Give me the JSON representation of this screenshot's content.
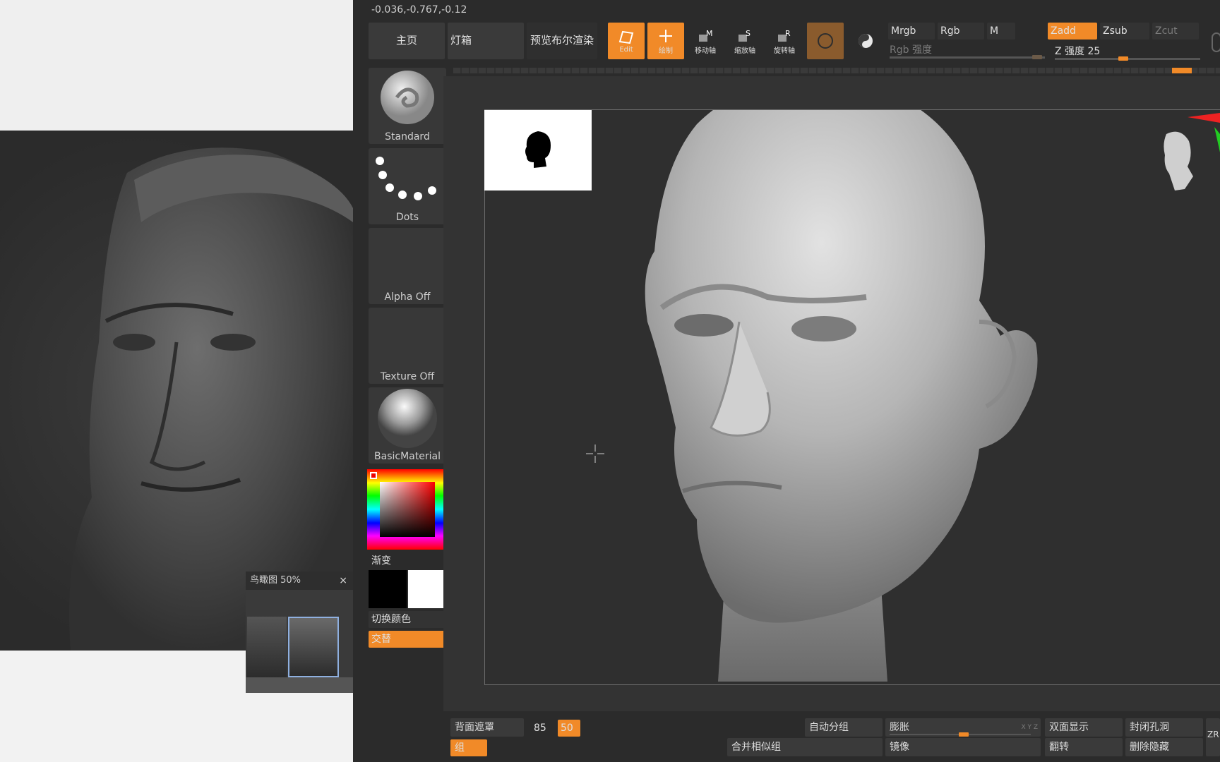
{
  "coords": "-0.036,-0.767,-0.12",
  "tabs": {
    "home": "主页",
    "lightbox": "灯箱",
    "preview_render": "预览布尔渲染"
  },
  "tools": {
    "edit": "Edit",
    "draw": "绘制",
    "move": "移动轴",
    "scale": "缩放轴",
    "rotate": "旋转轴",
    "move_badge": "M",
    "scale_badge": "S",
    "rotate_badge": "R"
  },
  "color_modes": {
    "mrgb": "Mrgb",
    "rgb": "Rgb",
    "m": "M",
    "rgb_intensity": "Rgb 强度"
  },
  "z_modes": {
    "zadd": "Zadd",
    "zsub": "Zsub",
    "zcut": "Zcut",
    "z_intensity_label": "Z 强度",
    "z_intensity_value": "25"
  },
  "palette": {
    "brush": "Standard",
    "stroke": "Dots",
    "alpha": "Alpha Off",
    "texture": "Texture Off",
    "material": "BasicMaterial",
    "gradient": "渐变",
    "switch_color": "切换颜色",
    "alternate": "交替"
  },
  "navigator": {
    "title": "鸟瞰图 50%",
    "close": "×"
  },
  "bottom": {
    "backface_mask": "背面遮罩",
    "backface_value1": "85",
    "backface_value2": "50",
    "group": "组",
    "auto_group": "自动分组",
    "merge_similar": "合并相似组",
    "inflate": "膨胀",
    "mirror": "镜像",
    "double_sided": "双面显示",
    "flip": "翻转",
    "close_holes": "封闭孔洞",
    "delete_hidden": "删除隐藏",
    "xyz": "X Y Z",
    "zr": "ZR"
  },
  "colors": {
    "accent": "#f18a28",
    "bg": "#2b2b2b",
    "panel": "#3a3a3a"
  }
}
